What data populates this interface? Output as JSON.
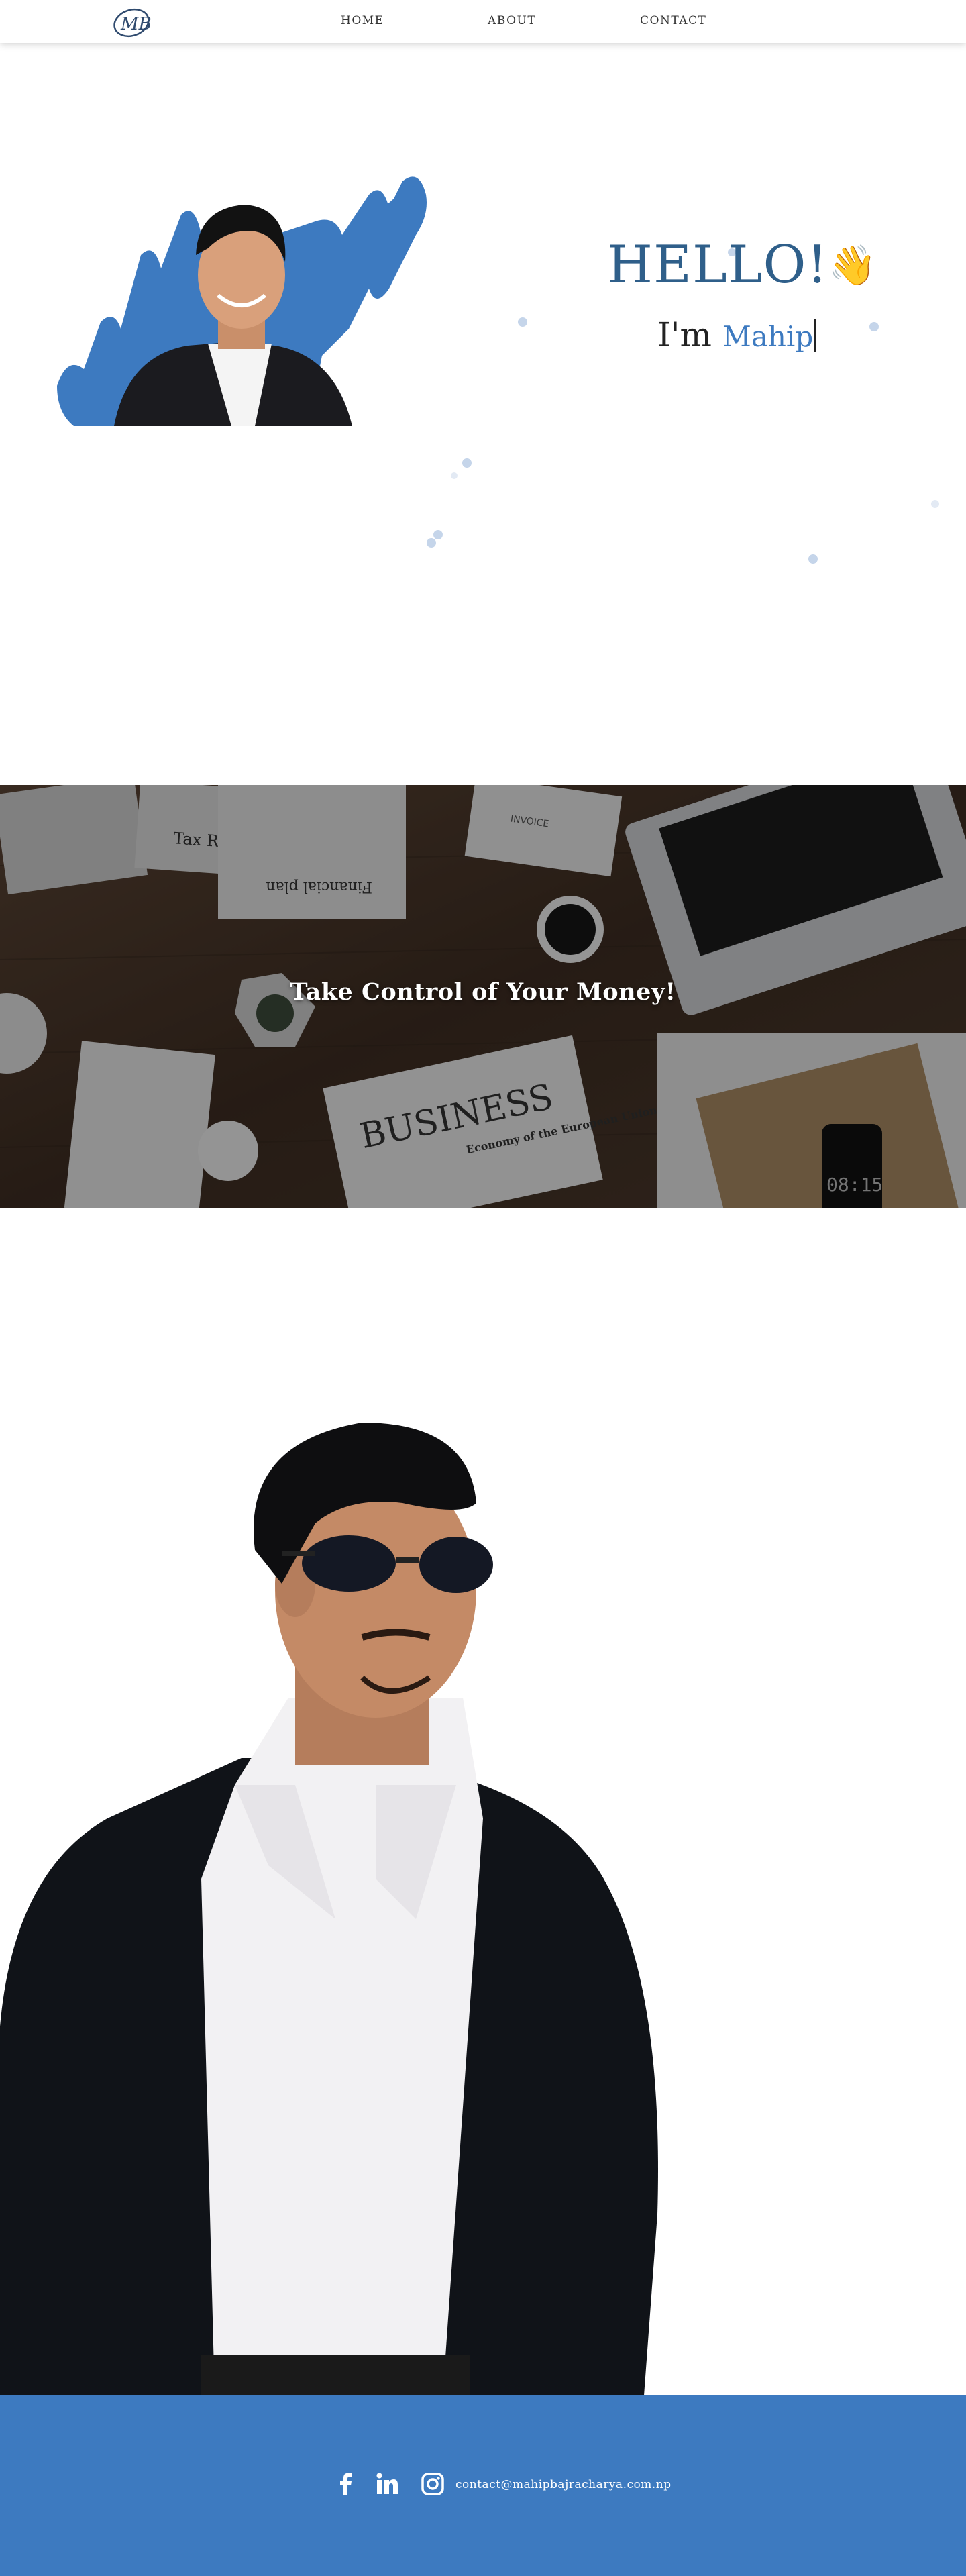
{
  "nav": {
    "logo_text": "MB",
    "links": [
      "HOME",
      "ABOUT",
      "CONTACT"
    ]
  },
  "hero": {
    "greeting": "HELLO!",
    "wave_emoji": "👋",
    "intro_prefix": "I'm",
    "name": "Mahip",
    "accent_color": "#3d7ac0",
    "greeting_color": "#2f5f8a"
  },
  "banner": {
    "title": "Take Control of Your Money!",
    "props": {
      "tax_form": "Tax Refund Form",
      "financial_plan": "Financial plan",
      "invoice": "INVOICE",
      "newspaper_headline": "BUSINESS",
      "newspaper_subhead": "Economy of the European Union",
      "phone_time": "08:15"
    }
  },
  "footer": {
    "icons": [
      "facebook-icon",
      "linkedin-icon",
      "instagram-icon"
    ],
    "email": "contact@mahipbajracharya.com.np",
    "background": "#3d7ac0"
  }
}
